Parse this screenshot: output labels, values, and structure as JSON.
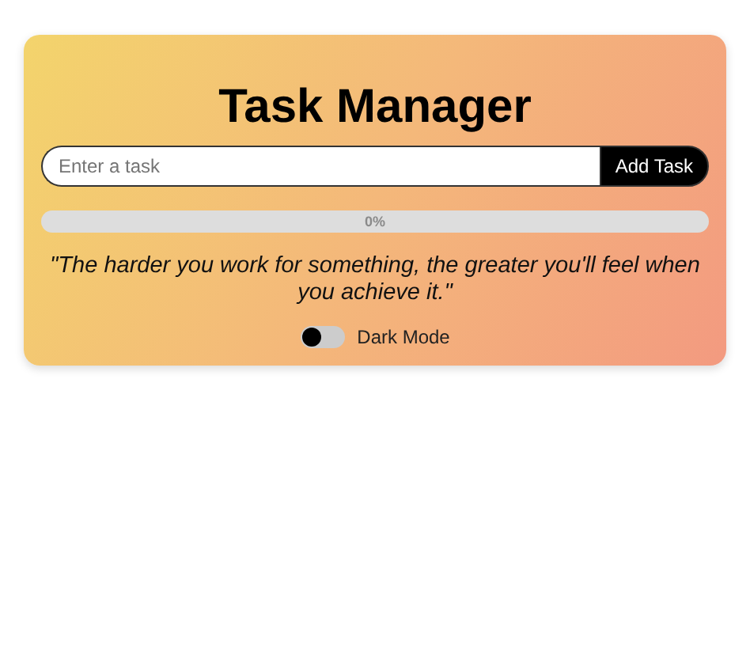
{
  "title": "Task Manager",
  "task_input": {
    "placeholder": "Enter a task"
  },
  "add_button": "Add Task",
  "progress": {
    "level": 0,
    "label": "0%"
  },
  "quote": "\"The harder you work for something, the greater you'll feel when you achieve it.\"",
  "dark_mode": {
    "label": "Dark Mode",
    "on": false
  }
}
